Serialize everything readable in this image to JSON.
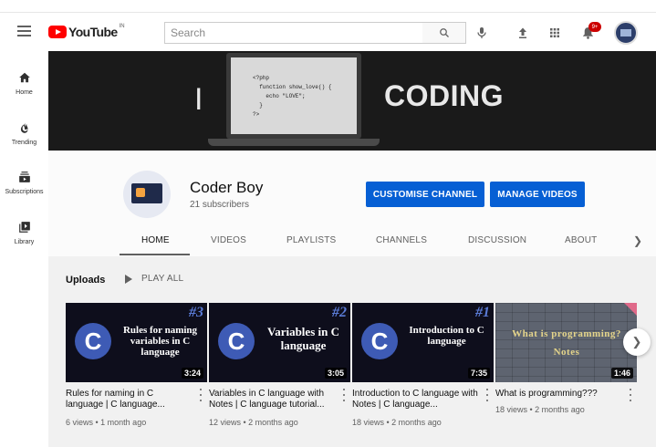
{
  "header": {
    "logo_text": "YouTube",
    "country": "IN",
    "search_placeholder": "Search",
    "notification_count": "9+"
  },
  "sidebar": {
    "items": [
      {
        "label": "Home",
        "icon": "home-icon"
      },
      {
        "label": "Trending",
        "icon": "fire-icon"
      },
      {
        "label": "Subscriptions",
        "icon": "subscriptions-icon"
      },
      {
        "label": "Library",
        "icon": "library-icon"
      }
    ]
  },
  "banner": {
    "left_text": "I",
    "right_text": "CODING",
    "code_lines": [
      "<?php",
      "  function show_love() {",
      "    echo \"LOVE\";",
      "  }",
      "?>"
    ]
  },
  "channel": {
    "name": "Coder Boy",
    "subscribers": "21 subscribers",
    "customise_label": "CUSTOMISE CHANNEL",
    "manage_label": "MANAGE VIDEOS"
  },
  "tabs": [
    "HOME",
    "VIDEOS",
    "PLAYLISTS",
    "CHANNELS",
    "DISCUSSION",
    "ABOUT"
  ],
  "active_tab": "HOME",
  "uploads": {
    "title": "Uploads",
    "play_all": "PLAY ALL"
  },
  "videos": [
    {
      "badge": "#3",
      "thumb_text": "Rules for naming variables in C language",
      "duration": "3:24",
      "title": "Rules for naming in C language | C language...",
      "meta": "6 views • 1 month ago"
    },
    {
      "badge": "#2",
      "thumb_text": "Variables in C language",
      "duration": "3:05",
      "title": "Variables in C language with Notes | C language tutorial...",
      "meta": "12 views • 2 months ago"
    },
    {
      "badge": "#1",
      "thumb_text": "Introduction to C language",
      "duration": "7:35",
      "title": "Introduction to C language with Notes | C language...",
      "meta": "18 views • 2 months ago"
    },
    {
      "badge": "",
      "thumb_text": "What is programming? Notes",
      "duration": "1:46",
      "title": "What is programming???",
      "meta": "18 views • 2 months ago"
    }
  ],
  "colors": {
    "accent": "#065fd4",
    "brand_red": "#ff0000",
    "content_bg": "#f1f1f1"
  }
}
